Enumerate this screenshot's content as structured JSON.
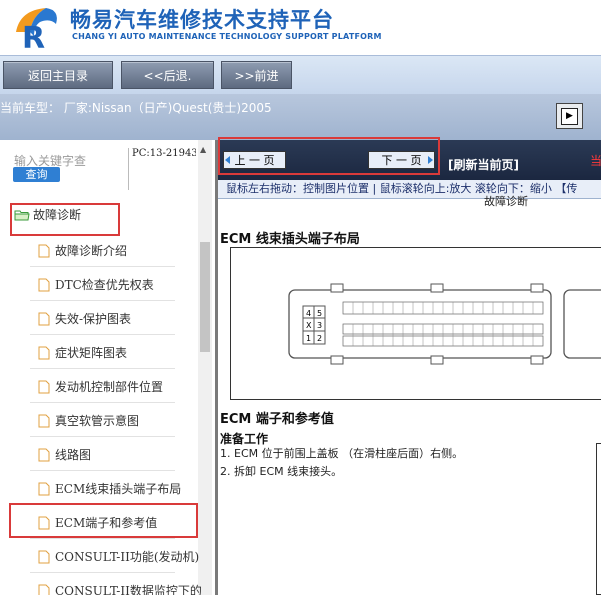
{
  "header": {
    "brand_cn": "畅易汽车维修技术支持平台",
    "brand_en": "CHANG YI AUTO MAINTENANCE TECHNOLOGY SUPPORT PLATFORM"
  },
  "nav": {
    "home": "返回主目录",
    "back": "<<后退.",
    "forward": ">>前进"
  },
  "model": {
    "text": "当前车型：  厂家:Nissan（日产)Quest(贵士)2005"
  },
  "sidebar": {
    "search_label": "输入关键字查",
    "query_button": "查询",
    "pc_code": "PC:13-21943",
    "folder": "故障诊断",
    "items": [
      "故障诊断介绍",
      "DTC检查优先权表",
      "失效-保护图表",
      "症状矩阵图表",
      "发动机控制部件位置",
      "真空软管示意图",
      "线路图",
      "ECM线束插头端子布局",
      "ECM端子和参考值",
      "CONSULT-II功能(发动机)",
      "CONSULT-II数据监控下的"
    ]
  },
  "main": {
    "prev_page": "上 一 页",
    "next_page": "下 一 页",
    "refresh": "[刷新当前页]",
    "current_cut": "当",
    "hint": "鼠标左右拖动：控制图片位置 | 鼠标滚轮向上:放大  滚轮向下：缩小 【传",
    "doc_top": "故障诊断",
    "section1": "ECM 线束插头端子布局",
    "section2": "ECM 端子和参考值",
    "prep": "准备工作",
    "steps": [
      "1.   ECM 位于前围上盖板 （在滑柱座后面）右侧。",
      "2.   拆卸 ECM 线束接头。"
    ]
  },
  "colors": {
    "brand_blue": "#1f63b8",
    "highlight_red": "#d93a3a",
    "query_blue": "#2f7fd3",
    "topbar_navy": "#1b2740"
  }
}
